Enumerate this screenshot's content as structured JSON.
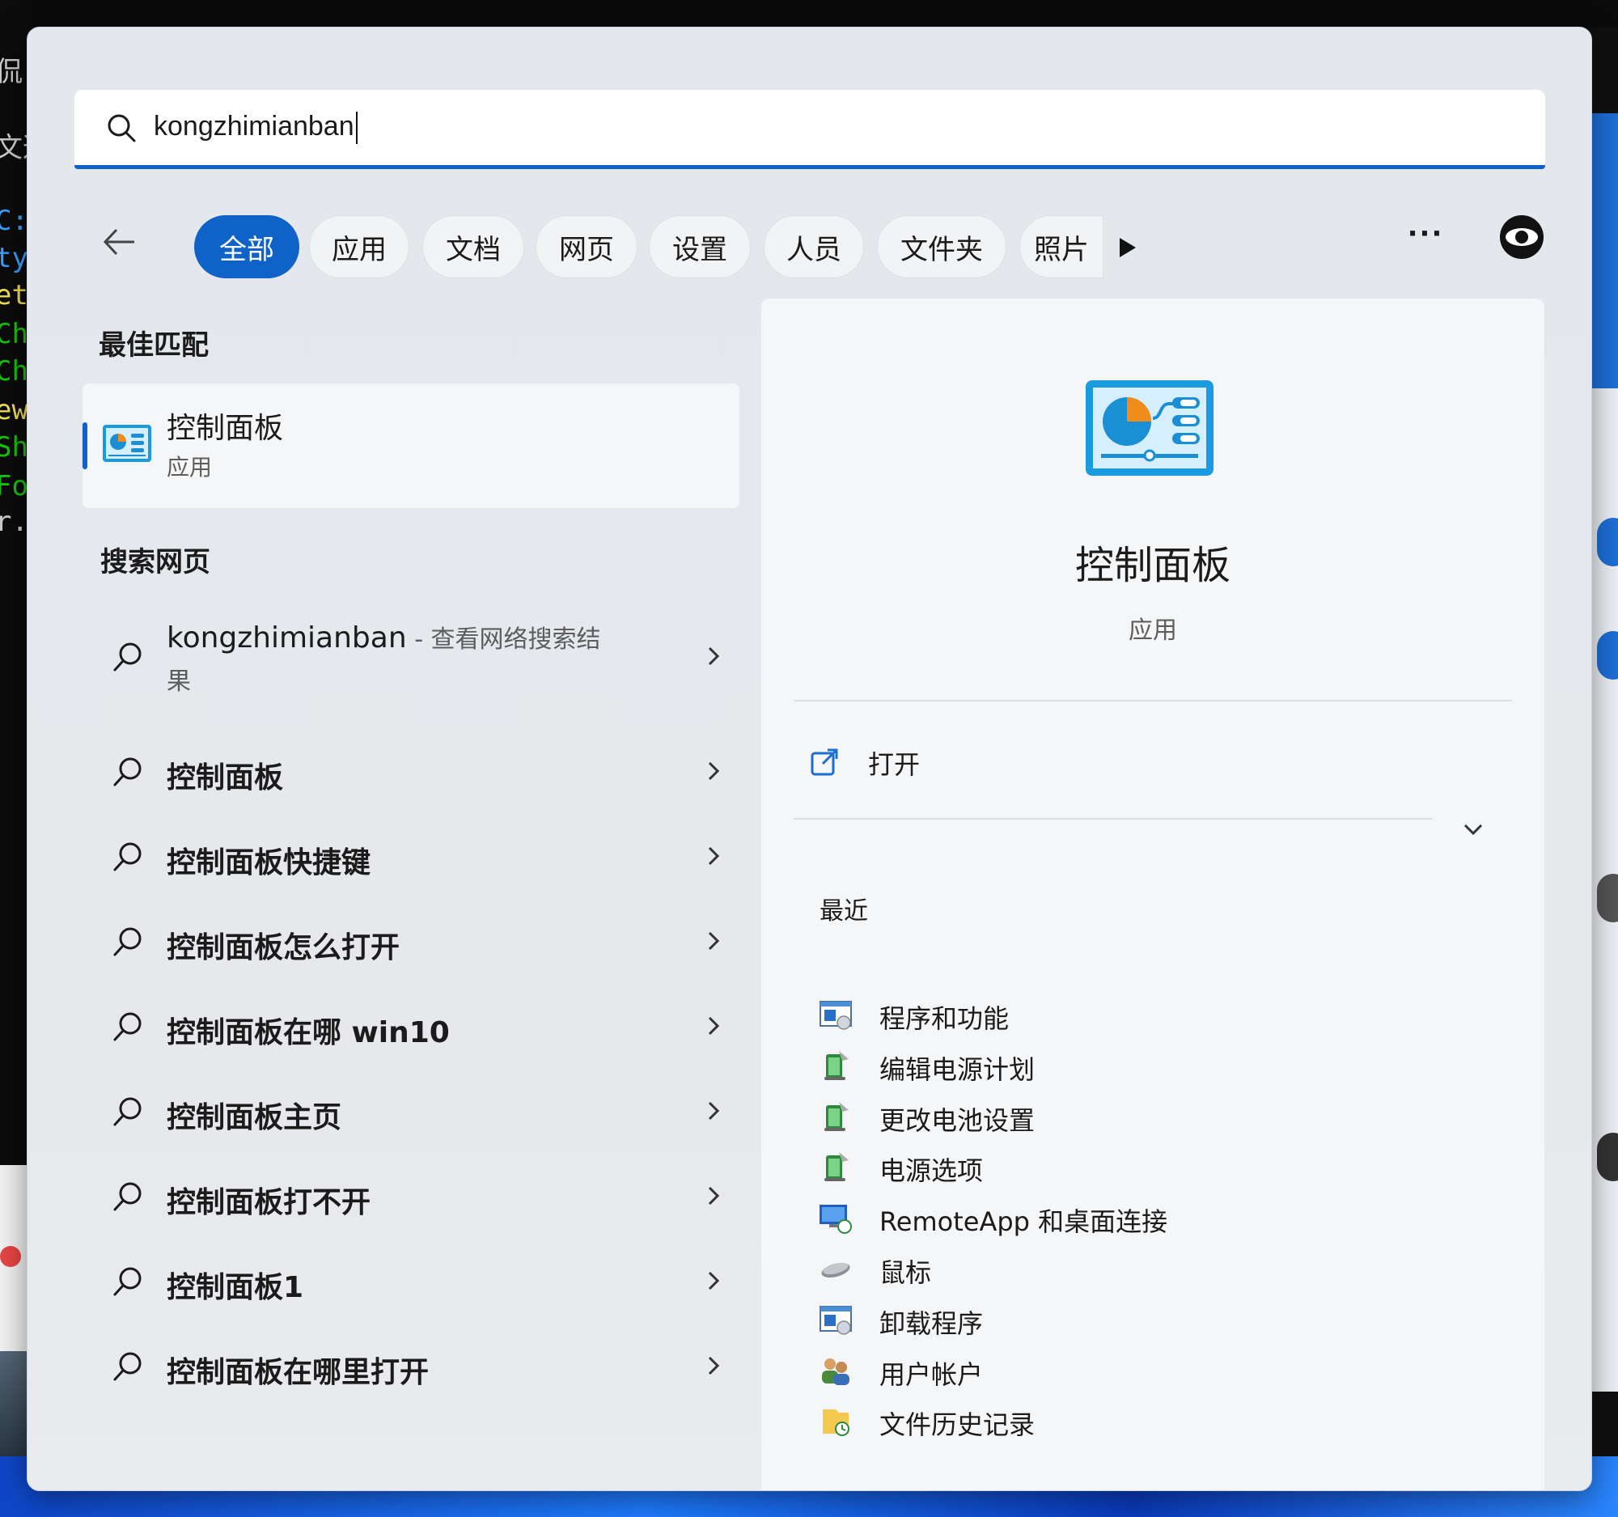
{
  "background": {
    "terminal_lines": [
      {
        "text": "侃",
        "color": "#cccccc"
      },
      {
        "text": "文这",
        "color": "#cccccc"
      },
      {
        "text": "C:",
        "color": "#3aa0ff"
      },
      {
        "text": "ty",
        "color": "#3aa0ff"
      },
      {
        "text": "et",
        "color": "#f1e05a"
      },
      {
        "text": "Ch",
        "color": "#16c60c"
      },
      {
        "text": "Ch",
        "color": "#16c60c"
      },
      {
        "text": "ew",
        "color": "#f1e05a"
      },
      {
        "text": "Sh",
        "color": "#16c60c"
      },
      {
        "text": "Fo",
        "color": "#16c60c"
      },
      {
        "text": "r.",
        "color": "#cccccc"
      }
    ]
  },
  "search": {
    "query": "kongzhimianban"
  },
  "filters": {
    "tabs": [
      {
        "label": "全部",
        "active": true
      },
      {
        "label": "应用",
        "active": false
      },
      {
        "label": "文档",
        "active": false
      },
      {
        "label": "网页",
        "active": false
      },
      {
        "label": "设置",
        "active": false
      },
      {
        "label": "人员",
        "active": false
      },
      {
        "label": "文件夹",
        "active": false
      },
      {
        "label": "照片",
        "active": false
      }
    ],
    "more_label": "···"
  },
  "best_match": {
    "section_title": "最佳匹配",
    "name": "控制面板",
    "type": "应用"
  },
  "web_search": {
    "section_title": "搜索网页",
    "first_query": "kongzhimianban",
    "first_suffix": " - 查看网络搜索结果",
    "suggestions": [
      "控制面板",
      "控制面板快捷键",
      "控制面板怎么打开",
      "控制面板在哪 win10",
      "控制面板主页",
      "控制面板打不开",
      "控制面板1",
      "控制面板在哪里打开"
    ]
  },
  "preview": {
    "title": "控制面板",
    "subtitle": "应用",
    "open_label": "打开",
    "recent_title": "最近",
    "recent_items": [
      {
        "label": "程序和功能",
        "icon": "programs-icon"
      },
      {
        "label": "编辑电源计划",
        "icon": "power-icon"
      },
      {
        "label": "更改电池设置",
        "icon": "power-icon"
      },
      {
        "label": "电源选项",
        "icon": "power-icon"
      },
      {
        "label": "RemoteApp 和桌面连接",
        "icon": "remote-desktop-icon"
      },
      {
        "label": "鼠标",
        "icon": "mouse-icon"
      },
      {
        "label": "卸载程序",
        "icon": "programs-icon"
      },
      {
        "label": "用户帐户",
        "icon": "users-icon"
      },
      {
        "label": "文件历史记录",
        "icon": "file-history-icon"
      }
    ]
  },
  "colors": {
    "accent": "#0f62c8",
    "window_bg": "#e4e7ec",
    "pane_bg": "#f5f6f8"
  }
}
